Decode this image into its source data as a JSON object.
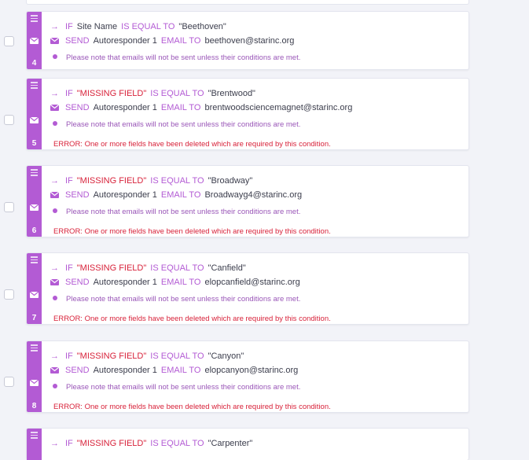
{
  "labels": {
    "if": "IF",
    "send": "SEND",
    "is_equal_to": "IS EQUAL TO",
    "email_to": "EMAIL TO",
    "note": "Please note that emails will not be sent unless their conditions are met.",
    "error": "ERROR:  One or more fields have been deleted which are required by this condition."
  },
  "colors": {
    "accent": "#b35bd4",
    "error": "#d8223a",
    "background": "#f2f3f8"
  },
  "conditions": [
    {
      "number": "4",
      "field": "Site Name",
      "value": "\"Beethoven\"",
      "responder": "Autoresponder 1",
      "email": "beethoven@starinc.org",
      "error": false
    },
    {
      "number": "5",
      "field": "\"MISSING FIELD\"",
      "value": "\"Brentwood\"",
      "responder": "Autoresponder 1",
      "email": "brentwoodsciencemagnet@starinc.org",
      "error": true
    },
    {
      "number": "6",
      "field": "\"MISSING FIELD\"",
      "value": "\"Broadway\"",
      "responder": "Autoresponder 1",
      "email": "Broadwayg4@starinc.org",
      "error": true
    },
    {
      "number": "7",
      "field": "\"MISSING FIELD\"",
      "value": "\"Canfield\"",
      "responder": "Autoresponder 1",
      "email": "elopcanfield@starinc.org",
      "error": true
    },
    {
      "number": "8",
      "field": "\"MISSING FIELD\"",
      "value": "\"Canyon\"",
      "responder": "Autoresponder 1",
      "email": "elopcanyon@starinc.org",
      "error": true
    },
    {
      "field": "\"MISSING FIELD\"",
      "value": "\"Carpenter\""
    }
  ]
}
